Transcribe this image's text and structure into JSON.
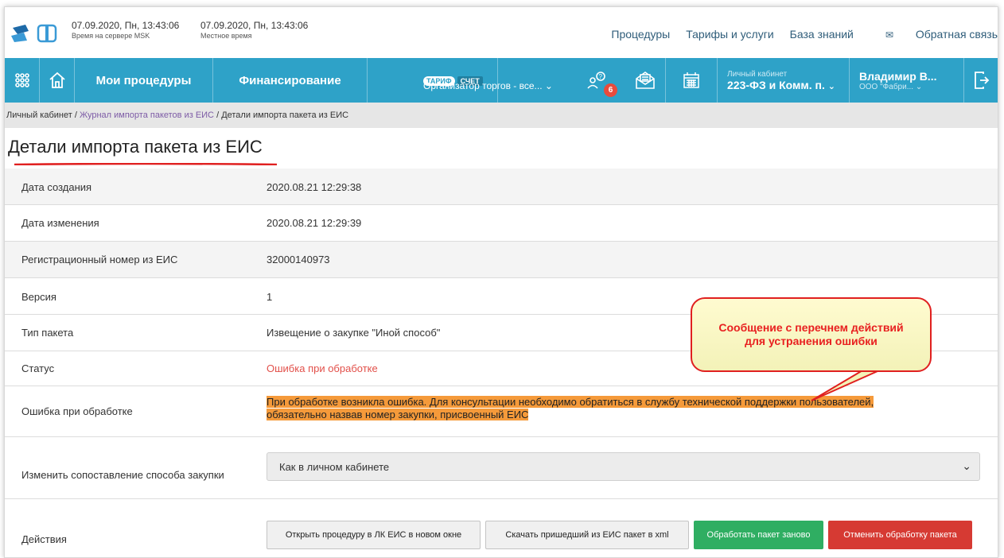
{
  "clock": {
    "server_time": "07.09.2020, Пн, 13:43:06",
    "server_label": "Время на сервере MSK",
    "local_time": "07.09.2020, Пн, 13:43:06",
    "local_label": "Местное время"
  },
  "topnav": {
    "procedures": "Процедуры",
    "tariffs": "Тарифы и услуги",
    "knowledge": "База знаний",
    "feedback": "Обратная связь"
  },
  "navbar": {
    "my_procedures": "Мои процедуры",
    "financing": "Финансирование",
    "tariff_tag": "ТАРИФ",
    "account_tag": "СЧЕТ",
    "tariff_value": "Организатор торгов - все...",
    "notif_count": "6",
    "cabinet_label": "Личный кабинет",
    "cabinet_value": "223-ФЗ и Комм. п.",
    "user_name": "Владимир В...",
    "user_org": "ООО \"Фабри..."
  },
  "breadcrumb": {
    "home": "Личный кабинет",
    "sep1": " / ",
    "journal": "Журнал импорта пакетов из ЕИС",
    "sep2": " / ",
    "current": "Детали импорта пакета из ЕИС"
  },
  "page": {
    "title": "Детали импорта пакета из ЕИС"
  },
  "details": {
    "created_label": "Дата создания",
    "created_value": "2020.08.21 12:29:38",
    "modified_label": "Дата изменения",
    "modified_value": "2020.08.21 12:29:39",
    "regnum_label": "Регистрационный номер из ЕИС",
    "regnum_value": "32000140973",
    "version_label": "Версия",
    "version_value": "1",
    "type_label": "Тип пакета",
    "type_value": "Извещение о закупке \"Иной способ\"",
    "status_label": "Статус",
    "status_value": "Ошибка при обработке",
    "error_label": "Ошибка при обработке",
    "error_line1": "При обработке возникла ошибка. Для консультации необходимо обратиться в службу технической поддержки пользователей,",
    "error_line2": "обязательно назвав номер закупки, присвоенный ЕИС",
    "mapping_label": "Изменить сопоставление способа закупки",
    "mapping_value": "Как в личном кабинете",
    "actions_label": "Действия"
  },
  "actions": {
    "open_eis": "Открыть процедуру в ЛК ЕИС в новом окне",
    "download_xml": "Скачать пришедший из ЕИС пакет в xml",
    "reprocess": "Обработать пакет заново",
    "cancel": "Отменить обработку пакета"
  },
  "callout": {
    "text": "Сообщение с перечнем действий для устранения ошибки"
  },
  "colors": {
    "nav_blue": "#2ea2c8",
    "status_error": "#e2504a",
    "highlight": "#f59a3a",
    "btn_green": "#2fae62",
    "btn_red": "#d63a33",
    "callout_red": "#e02020"
  }
}
